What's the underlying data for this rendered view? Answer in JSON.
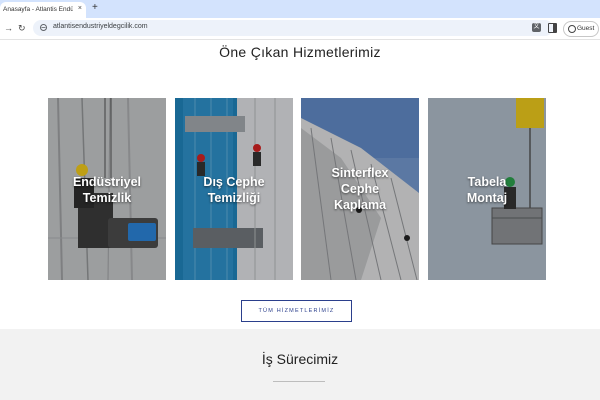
{
  "browser": {
    "tab_title": "Anasayfa - Atlantis Endüstriy",
    "tab_close": "×",
    "new_tab": "+",
    "url": "atlantisendustriyeldegcilik.com",
    "guest_label": "Guest"
  },
  "services": {
    "title": "Öne Çıkan Hizmetlerimiz",
    "cards": [
      {
        "title_line1": "Endüstriyel",
        "title_line2": "Temizlik"
      },
      {
        "title_line1": "Dış Cephe",
        "title_line2": "Temizliği"
      },
      {
        "title_line1": "Sinterflex",
        "title_line2": "Cephe",
        "title_line3": "Kaplama"
      },
      {
        "title_line1": "Tabela",
        "title_line2": "Montaj"
      }
    ],
    "all_button": "TÜM HİZMETLERİMİZ"
  },
  "process": {
    "title": "İş Sürecimiz"
  },
  "colors": {
    "accent": "#2b3f8c",
    "tabbar": "#d3e3fd",
    "process_bg": "#f2f2f2"
  }
}
